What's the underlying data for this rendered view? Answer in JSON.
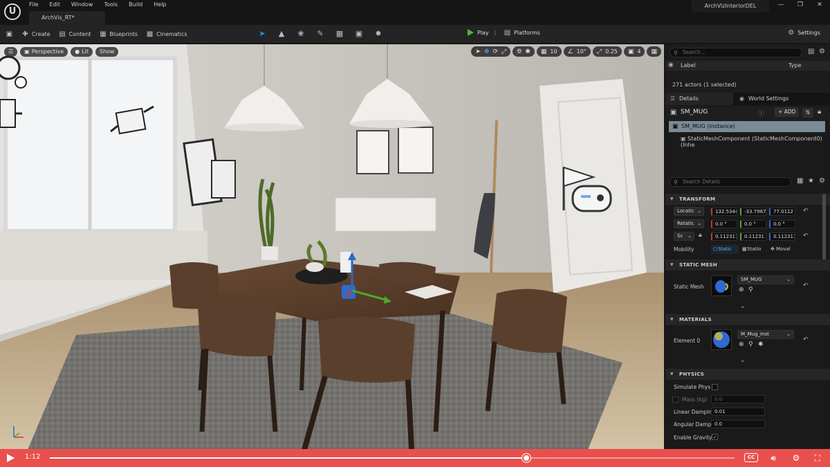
{
  "menu": [
    "File",
    "Edit",
    "Window",
    "Tools",
    "Build",
    "Help"
  ],
  "document_tab": "ArchVis_RT*",
  "project_name": "ArchVizInteriorDEL",
  "window_buttons": [
    "—",
    "❐",
    "✕"
  ],
  "toolbar": {
    "create": "Create",
    "content": "Content",
    "blueprints": "Blueprints",
    "cinematics": "Cinematics",
    "play": "Play",
    "play_more": "⋮",
    "platforms": "Platforms",
    "settings": "Settings"
  },
  "viewport": {
    "perspective": "Perspective",
    "lit": "Lit",
    "show": "Show",
    "grid_snap": "10",
    "rotation_snap": "10°",
    "scale_snap": "0.25",
    "camera_speed": "4"
  },
  "outliner": {
    "search_placeholder": "Search...",
    "col_label": "Label",
    "col_type": "Type",
    "actor_count": "271 actors (1 selected)"
  },
  "details": {
    "tab_details": "Details",
    "tab_world": "World Settings",
    "object_name": "SM_MUG",
    "add_label": "ADD",
    "instance": "SM_MUG (Instance)",
    "component": "StaticMeshComponent (StaticMeshComponent0) (Inhe",
    "search_placeholder": "Search Details"
  },
  "transform": {
    "header": "TRANSFORM",
    "location_label": "Locatic",
    "location": [
      "132.5344",
      "-33.7967",
      "77.0112"
    ],
    "rotation_label": "Rotatic",
    "rotation": [
      "0.0 °",
      "0.0 °",
      "0.0 °"
    ],
    "scale_label": "Sc",
    "scale": [
      "0.112311",
      "0.11231",
      "0.112311"
    ],
    "mobility_label": "Mobility",
    "mobility_options": [
      "Static",
      "Statio",
      "Moval"
    ],
    "mobility_selected": "Static"
  },
  "static_mesh": {
    "header": "STATIC MESH",
    "label": "Static Mesh",
    "value": "SM_MUG"
  },
  "materials": {
    "header": "MATERIALS",
    "label": "Element 0",
    "value": "M_Mug_Inst"
  },
  "physics": {
    "header": "PHYSICS",
    "simulate_label": "Simulate Phys",
    "mass_label": "Mass (kg)",
    "mass_value": "0.0",
    "linear_label": "Linear Dampin",
    "linear_value": "0.01",
    "angular_label": "Angular Dampi",
    "angular_value": "0.0",
    "gravity_label": "Enable Gravity"
  },
  "video": {
    "time": "1:12",
    "progress": 0.696,
    "cc": "CC"
  },
  "colors": {
    "accent_blue": "#2f8fe6",
    "play_green": "#56b339",
    "video_red": "#e9504d",
    "selection": "#7a8a97"
  }
}
